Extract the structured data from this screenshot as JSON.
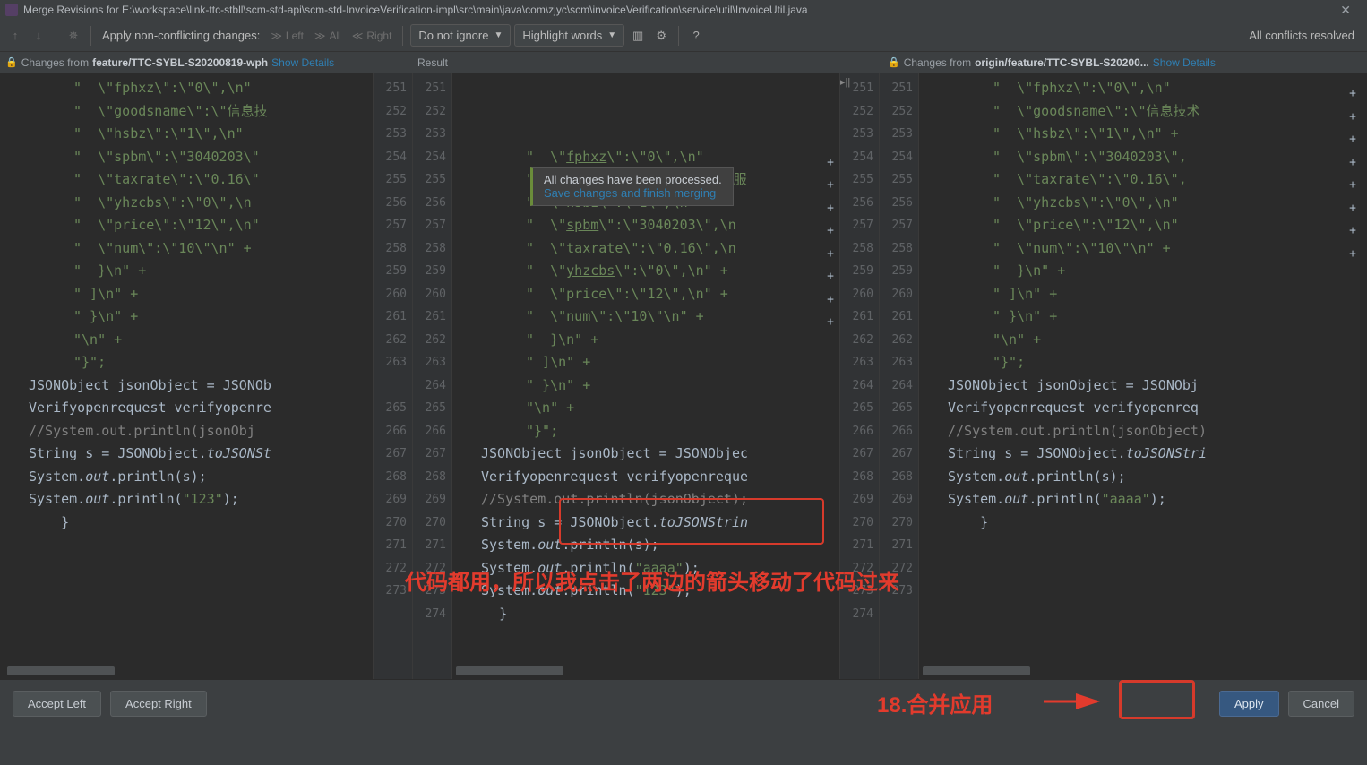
{
  "title": "Merge Revisions for E:\\workspace\\link-ttc-stbll\\scm-std-api\\scm-std-InvoiceVerification-impl\\src\\main\\java\\com\\zjyc\\scm\\invoiceVerification\\service\\util\\InvoiceUtil.java",
  "toolbar": {
    "apply_label": "Apply non-conflicting changes:",
    "left": "Left",
    "all": "All",
    "right": "Right",
    "combo1": "Do not ignore",
    "combo2": "Highlight words",
    "status": "All conflicts resolved"
  },
  "headers": {
    "left_prefix": "Changes from ",
    "left_branch": "feature/TTC-SYBL-S20200819-wph",
    "mid": "Result",
    "right_prefix": "Changes from ",
    "right_branch": "origin/feature/TTC-SYBL-S20200...",
    "show_details": "Show Details"
  },
  "tooltip": {
    "line1": "All changes have been processed.",
    "line2": "Save changes and finish merging"
  },
  "code": {
    "left_lines": [
      "251",
      "252",
      "253",
      "254",
      "255",
      "256",
      "257",
      "258",
      "259",
      "260",
      "261",
      "262",
      "263",
      "",
      "265",
      "266",
      "267",
      "268",
      "269",
      "270",
      "271",
      "272",
      "273"
    ],
    "mid_lines": [
      "251",
      "252",
      "253",
      "254",
      "255",
      "256",
      "257",
      "258",
      "259",
      "260",
      "261",
      "262",
      "263",
      "264",
      "265",
      "266",
      "267",
      "268",
      "269",
      "270",
      "271",
      "272",
      "273",
      "274"
    ],
    "right_lines": [
      "251",
      "252",
      "253",
      "254",
      "255",
      "256",
      "257",
      "258",
      "259",
      "260",
      "261",
      "262",
      "263",
      "264",
      "265",
      "266",
      "267",
      "268",
      "269",
      "270",
      "271",
      "272",
      "273"
    ],
    "left": [
      "\"  \\\"fphxz\\\":\\\"0\\\",\\n\"",
      "\"  \\\"goodsname\\\":\\\"信息技",
      "\"  \\\"hsbz\\\":\\\"1\\\",\\n\" ",
      "\"  \\\"spbm\\\":\\\"3040203\\\"",
      "\"  \\\"taxrate\\\":\\\"0.16\\\"",
      "\"  \\\"yhzcbs\\\":\\\"0\\\",\\n",
      "\"  \\\"price\\\":\\\"12\\\",\\n\"",
      "\"  \\\"num\\\":\\\"10\\\"\\n\" +",
      "\"  }\\n\" +",
      "\" ]\\n\" +",
      "\" }\\n\" +",
      "\"\\n\" +",
      "\"}\";",
      "",
      "JSONObject jsonObject = JSONOb",
      "Verifyopenrequest verifyopenre",
      "//System.out.println(jsonObj",
      "String s = JSONObject.toJSONSt",
      "System.out.println(s);",
      "System.out.println(\"123\");",
      "}",
      "",
      ""
    ],
    "mid": [
      "\"  \\\"fphxz\\\":\\\"0\\\",\\n\" ",
      "\"  \\\"goodsname\\\":\\\"信息技术服",
      "\"  \\\"hsbz\\\":\\\"1\\\",\\n\" +",
      "\"  \\\"spbm\\\":\\\"3040203\\\",\\n",
      "\"  \\\"taxrate\\\":\\\"0.16\\\",\\n",
      "\"  \\\"yhzcbs\\\":\\\"0\\\",\\n\" +",
      "\"  \\\"price\\\":\\\"12\\\",\\n\" +",
      "\"  \\\"num\\\":\\\"10\\\"\\n\" +",
      "\"  }\\n\" +",
      "\" ]\\n\" +",
      "\" }\\n\" +",
      "\"\\n\" +",
      "\"}\";",
      "",
      "JSONObject jsonObject = JSONObjec",
      "Verifyopenrequest verifyopenreque",
      "//System.out.println(jsonObject);",
      "String s = JSONObject.toJSONStrin",
      "System.out.println(s);",
      "System.out.println(\"aaaa\");",
      "System.out.println(\"123\");",
      "}",
      "",
      ""
    ],
    "right": [
      "\"  \\\"fphxz\\\":\\\"0\\\",\\n\" ",
      "\"  \\\"goodsname\\\":\\\"信息技术",
      "\"  \\\"hsbz\\\":\\\"1\\\",\\n\" +",
      "\"  \\\"spbm\\\":\\\"3040203\\\",",
      "\"  \\\"taxrate\\\":\\\"0.16\\\",",
      "\"  \\\"yhzcbs\\\":\\\"0\\\",\\n\"",
      "\"  \\\"price\\\":\\\"12\\\",\\n\"",
      "\"  \\\"num\\\":\\\"10\\\"\\n\" +",
      "\"  }\\n\" +",
      "\" ]\\n\" +",
      "\" }\\n\" +",
      "\"\\n\" +",
      "\"}\";",
      "",
      "JSONObject jsonObject = JSONObj",
      "Verifyopenrequest verifyopenreq",
      "//System.out.println(jsonObject)",
      "String s = JSONObject.toJSONStri",
      "System.out.println(s);",
      "System.out.println(\"aaaa\");",
      "}",
      "",
      ""
    ]
  },
  "annotations": {
    "note1": "代码都用，所以我点击了两边的箭头移动了代码过来",
    "note2": "18.合并应用"
  },
  "buttons": {
    "accept_left": "Accept Left",
    "accept_right": "Accept Right",
    "apply": "Apply",
    "cancel": "Cancel"
  }
}
